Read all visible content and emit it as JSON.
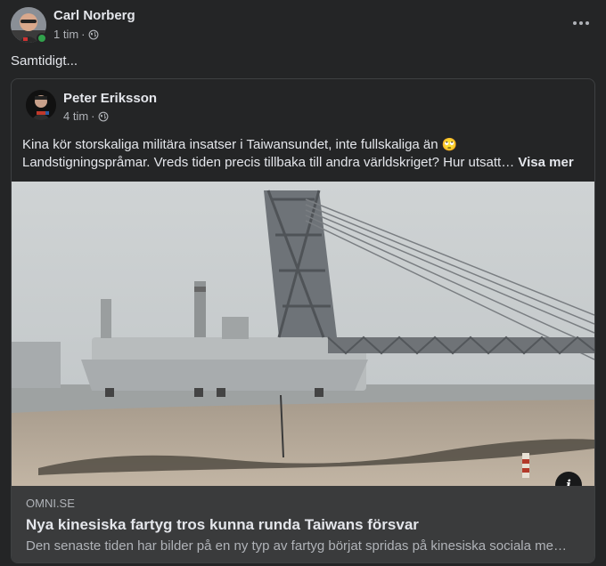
{
  "post": {
    "author": "Carl Norberg",
    "time": "1 tim",
    "separator": "·",
    "text": "Samtidigt...",
    "online": true
  },
  "shared": {
    "author": "Peter Eriksson",
    "time": "4 tim",
    "separator": "·",
    "text_line1": "Kina kör storskaliga militära insatser i Taiwansundet, inte fullskaliga än",
    "emoji": "🙄",
    "text_line2": "Landstigningspråmar. Vreds tiden precis tillbaka till andra världskriget? Hur utsatt…",
    "see_more": "Visa mer"
  },
  "link": {
    "domain": "OMNI.SE",
    "title": "Nya kinesiska fartyg tros kunna runda Taiwans försvar",
    "description": "Den senaste tiden har bilder på en ny typ av fartyg börjat spridas på kinesiska sociala medier…",
    "info_label": "i"
  },
  "icons": {
    "more": "more-horizontal-icon",
    "privacy": "globe-icon",
    "info": "info-icon"
  },
  "colors": {
    "background": "#242526",
    "card_footer": "#3a3b3c",
    "online": "#31a24c",
    "secondary_text": "#b0b3b8"
  }
}
